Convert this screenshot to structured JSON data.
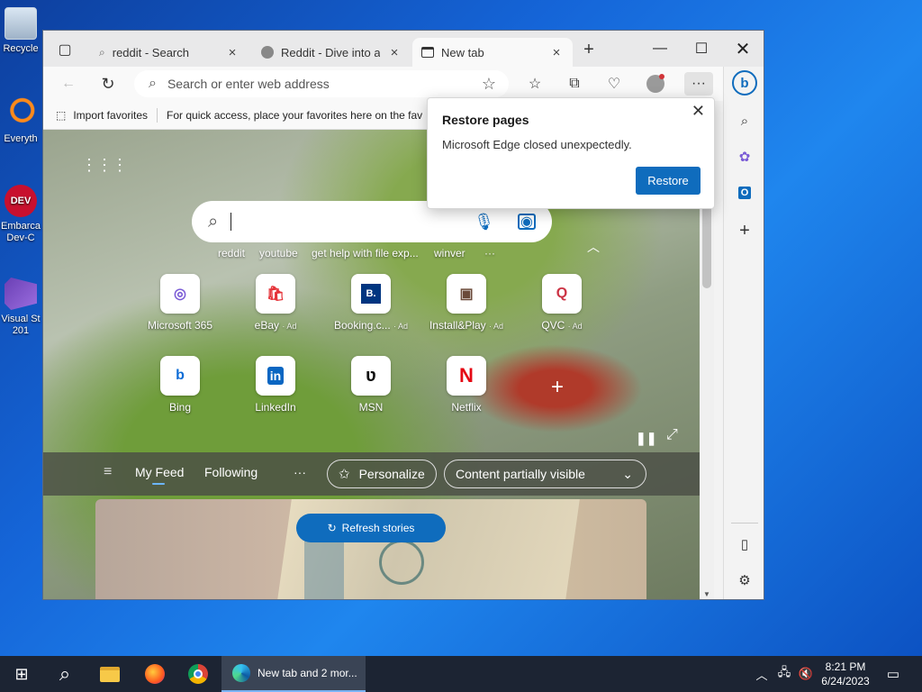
{
  "desktop": {
    "icons": [
      {
        "label": "Recycle",
        "icon": "recycle-bin-icon"
      },
      {
        "label": "Everyth",
        "icon": "everything-search-icon"
      },
      {
        "label": "Embarca Dev-C",
        "icon": "dev-cpp-icon"
      },
      {
        "label": "Visual St 201",
        "icon": "visual-studio-icon"
      }
    ]
  },
  "browser": {
    "tabs": [
      {
        "label": "reddit - Search",
        "icon": "search-icon"
      },
      {
        "label": "Reddit - Dive into any",
        "icon": "reddit-icon"
      },
      {
        "label": "New tab",
        "icon": "new-tab-icon"
      }
    ],
    "address_placeholder": "Search or enter web address",
    "favorites_bar": {
      "import_label": "Import favorites",
      "hint": "For quick access, place your favorites here on the fav"
    },
    "new_tab": {
      "suggestions": [
        "reddit",
        "youtube",
        "get help with file exp...",
        "winver",
        "···"
      ],
      "tiles_row1": [
        {
          "name": "Microsoft 365",
          "ad": "",
          "glyph": "◎",
          "color": "#7b5cd6"
        },
        {
          "name": "eBay",
          "ad": "· Ad",
          "glyph": "🛍",
          "color": "#e53238"
        },
        {
          "name": "Booking.c...",
          "ad": "· Ad",
          "glyph": "B.",
          "color": "#003580"
        },
        {
          "name": "Install&Play",
          "ad": "· Ad",
          "glyph": "▣",
          "color": "#6b4a3a"
        },
        {
          "name": "QVC",
          "ad": "· Ad",
          "glyph": "Q",
          "color": "#cc3344"
        }
      ],
      "tiles_row2": [
        {
          "name": "Bing",
          "glyph": "b",
          "color": "#0c6cd6"
        },
        {
          "name": "LinkedIn",
          "glyph": "in",
          "color": "#0a66c2"
        },
        {
          "name": "MSN",
          "glyph": "ʋ",
          "color": "#111111"
        },
        {
          "name": "Netflix",
          "glyph": "N",
          "color": "#e50914"
        }
      ],
      "feed": {
        "my_feed": "My Feed",
        "following": "Following",
        "more": "···",
        "personalize": "Personalize",
        "content_visible": "Content partially visible",
        "refresh": "Refresh stories"
      }
    },
    "restore_popup": {
      "title": "Restore pages",
      "message": "Microsoft Edge closed unexpectedly.",
      "button": "Restore"
    }
  },
  "taskbar": {
    "active_window": "New tab and 2 mor...",
    "time": "8:21 PM",
    "date": "6/24/2023"
  },
  "colors": {
    "accent": "#0f6cbd",
    "feed_bar": "#4b4e46",
    "taskbar": "#1c2433"
  }
}
